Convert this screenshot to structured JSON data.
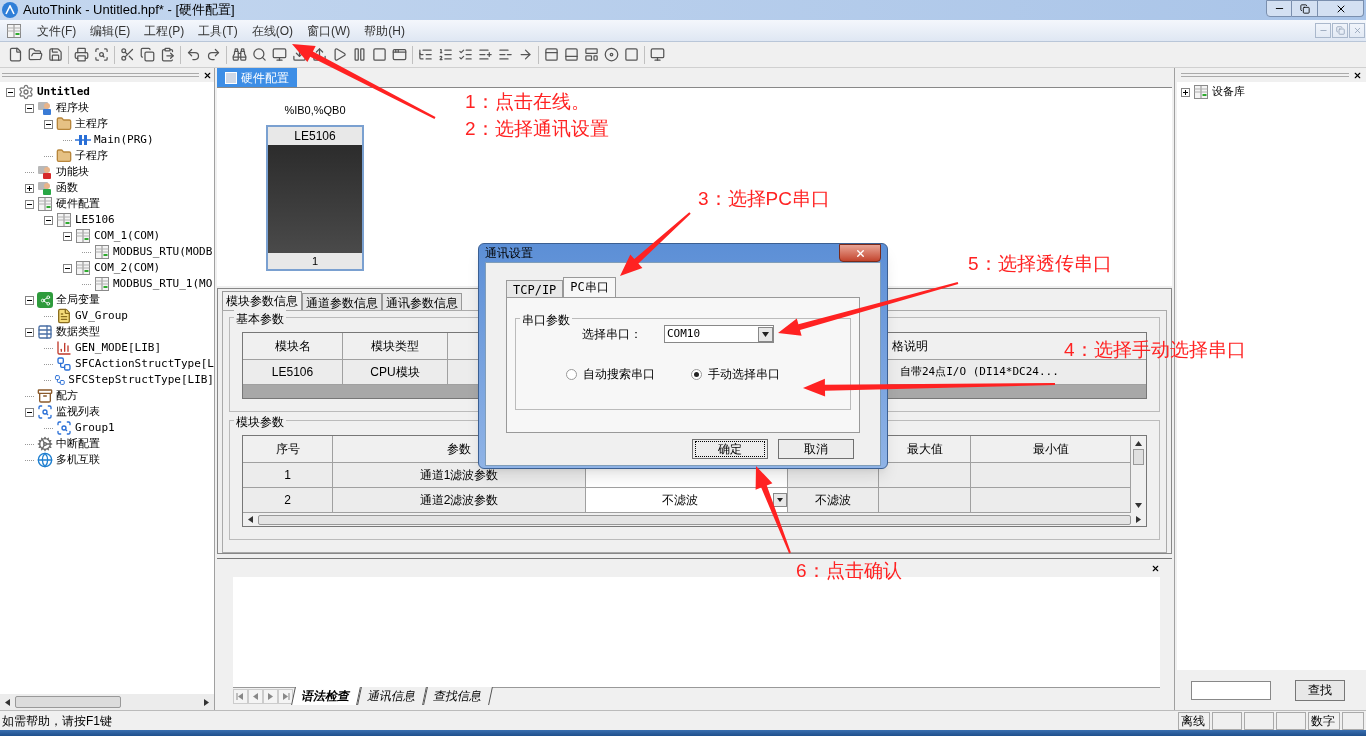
{
  "window": {
    "title": "AutoThink - Untitled.hpf* - [硬件配置]"
  },
  "menu": [
    "文件(F)",
    "编辑(E)",
    "工程(P)",
    "工具(T)",
    "在线(O)",
    "窗口(W)",
    "帮助(H)"
  ],
  "project_tree": [
    {
      "label": "Untitled",
      "kind": "gear",
      "bold": true,
      "expanded": true,
      "children": [
        {
          "label": "程序块",
          "kind": "userblue",
          "expanded": true,
          "children": [
            {
              "label": "主程序",
              "kind": "folder",
              "expanded": true,
              "children": [
                {
                  "label": "Main(PRG)",
                  "kind": "program"
                }
              ]
            },
            {
              "label": "子程序",
              "kind": "folder"
            }
          ]
        },
        {
          "label": "功能块",
          "kind": "userred"
        },
        {
          "label": "函数",
          "kind": "usergreen",
          "expanded": false
        },
        {
          "label": "硬件配置",
          "kind": "hardware",
          "expanded": true,
          "children": [
            {
              "label": "LE5106",
              "kind": "hardware",
              "expanded": true,
              "children": [
                {
                  "label": "COM_1(COM)",
                  "kind": "hardware",
                  "expanded": true,
                  "children": [
                    {
                      "label": "MODBUS_RTU(MODB",
                      "kind": "hardware"
                    }
                  ]
                },
                {
                  "label": "COM_2(COM)",
                  "kind": "hardware",
                  "expanded": true,
                  "children": [
                    {
                      "label": "MODBUS_RTU_1(MO",
                      "kind": "hardware"
                    }
                  ]
                }
              ]
            }
          ]
        },
        {
          "label": "全局变量",
          "kind": "share",
          "expanded": true,
          "children": [
            {
              "label": "GV_Group",
              "kind": "note"
            }
          ]
        },
        {
          "label": "数据类型",
          "kind": "datatype",
          "expanded": true,
          "children": [
            {
              "label": "GEN_MODE[LIB]",
              "kind": "barchart"
            },
            {
              "label": "SFCActionStructType[L",
              "kind": "struct"
            },
            {
              "label": "SFCStepStructType[LIB]",
              "kind": "struct"
            }
          ]
        },
        {
          "label": "配方",
          "kind": "recipe"
        },
        {
          "label": "监视列表",
          "kind": "monitor",
          "expanded": true,
          "children": [
            {
              "label": "Group1",
              "kind": "monitor"
            }
          ]
        },
        {
          "label": "中断配置",
          "kind": "interrupt"
        },
        {
          "label": "多机互联",
          "kind": "network"
        }
      ]
    }
  ],
  "editor_tab": {
    "label": "硬件配置",
    "selected": true
  },
  "hardware": {
    "address": "%IB0,%QB0",
    "module": "LE5106",
    "slot": "1"
  },
  "property_tabs": [
    {
      "label": "模块参数信息",
      "selected": true
    },
    {
      "label": "通道参数信息",
      "selected": false
    },
    {
      "label": "通讯参数信息",
      "selected": false
    }
  ],
  "basic_params": {
    "title": "基本参数",
    "columns": [
      "模块名",
      "模块类型",
      "格说明"
    ],
    "rows": [
      [
        "LE5106",
        "CPU模块",
        "自带24点I/O (DI14*DC24..."
      ]
    ]
  },
  "module_params": {
    "title": "模块参数",
    "columns": [
      "序号",
      "参数",
      "最大值",
      "最小值"
    ],
    "rows": [
      {
        "index": "1",
        "name": "通道1滤波参数"
      },
      {
        "index": "2",
        "name": "通道2滤波参数",
        "value": "不滤波",
        "column_4": "不滤波"
      }
    ]
  },
  "output_tabs": [
    {
      "label": "语法检查",
      "selected": true
    },
    {
      "label": "通讯信息",
      "selected": false
    },
    {
      "label": "查找信息",
      "selected": false
    }
  ],
  "device_library": [
    {
      "label": "设备库",
      "kind": "hardware",
      "expanded": false
    }
  ],
  "search_button": "查找",
  "status_bar": {
    "help": "如需帮助，请按F1键",
    "mode": "离线",
    "num": "数字"
  },
  "dialog": {
    "title": "通讯设置",
    "tabs": [
      {
        "label": "TCP/IP",
        "selected": false
      },
      {
        "label": "PC串口",
        "selected": true
      }
    ],
    "group": "串口参数",
    "port_label": "选择串口：",
    "port_value": "COM10",
    "radios": [
      {
        "label": "自动搜索串口",
        "selected": false
      },
      {
        "label": "手动选择串口",
        "selected": true
      }
    ],
    "buttons": [
      "确定",
      "取消"
    ]
  },
  "annotations": [
    "1：点击在线。",
    "2：选择通讯设置",
    "3：选择PC串口",
    "5：选择透传串口",
    "4：选择手动选择串口",
    "6：点击确认"
  ]
}
